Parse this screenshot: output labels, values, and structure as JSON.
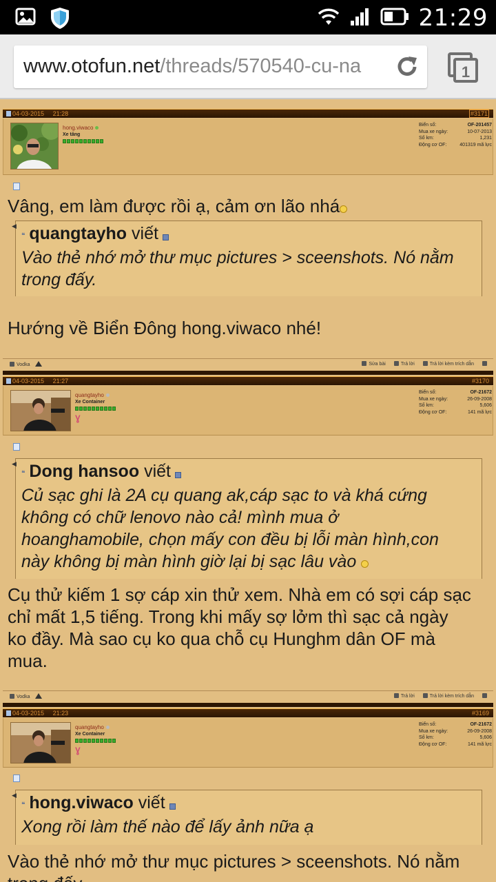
{
  "status_bar": {
    "time": "21:29"
  },
  "browser": {
    "url_domain": "www.otofun.net",
    "url_path": "/threads/570540-cu-na",
    "tab_count": "1"
  },
  "posts": [
    {
      "date": "04-03-2015",
      "time": "21:28",
      "number": "#3171",
      "username": "hong.viwaco",
      "rank": "Xe tăng",
      "stats": [
        {
          "label": "Biển số:",
          "value": "OF-201457"
        },
        {
          "label": "Mua xe ngày:",
          "value": "10-07-2013"
        },
        {
          "label": "Số km:",
          "value": "1,231"
        },
        {
          "label": "Động cơ OF:",
          "value": "401319 mã lực"
        }
      ],
      "message": "Vâng, em làm được rồi ạ, cảm ơn lão nhá",
      "quote_author": "quangtayho",
      "quote_word": "viết",
      "quote_lines": [
        "Vào thẻ nhớ mở thư mục pictures > sceenshots. Nó nằm",
        "trong đấy."
      ],
      "reply_text": "Hướng về Biển Đông hong.viwaco nhé!",
      "footer_user": "Vodka",
      "actions": [
        "Sửa bài",
        "Trả lời",
        "Trả lời kèm trích dẫn"
      ]
    },
    {
      "date": "04-03-2015",
      "time": "21:27",
      "number": "#3170",
      "username": "quangtayho",
      "rank": "Xe Container",
      "stats": [
        {
          "label": "Biển số:",
          "value": "OF-21672"
        },
        {
          "label": "Mua xe ngày:",
          "value": "26-09-2008"
        },
        {
          "label": "Số km:",
          "value": "5,606"
        },
        {
          "label": "Động cơ OF:",
          "value": "141 mã lực"
        }
      ],
      "quote_author": "Dong hansoo",
      "quote_word": "viết",
      "quote_lines": [
        "Củ sạc ghi là 2A cụ quang ak,cáp sạc to và khá cứng",
        "không có chữ lenovo nào cả! mình mua ở",
        "hoanghamobile, chọn mấy con đều bị lỗi màn hình,con",
        "này không bị màn hình giờ lại bị sạc lâu vào"
      ],
      "reply_lines": [
        "Cụ thử kiếm 1 sợ cáp xin thử xem. Nhà em có sợi cáp sạc",
        "chỉ mất 1,5 tiếng. Trong khi mấy sợ lởm thì sạc cả ngày",
        "ko đầy. Mà sao cụ ko qua chỗ cụ Hunghm dân OF mà",
        "mua."
      ],
      "footer_user": "Vodka",
      "actions": [
        "Trả lời",
        "Trả lời kèm trích dẫn"
      ]
    },
    {
      "date": "04-03-2015",
      "time": "21:23",
      "number": "#3169",
      "username": "quangtayho",
      "rank": "Xe Container",
      "stats": [
        {
          "label": "Biển số:",
          "value": "OF-21672"
        },
        {
          "label": "Mua xe ngày:",
          "value": "26-09-2008"
        },
        {
          "label": "Số km:",
          "value": "5,606"
        },
        {
          "label": "Động cơ OF:",
          "value": "141 mã lực"
        }
      ],
      "quote_author": "hong.viwaco",
      "quote_word": "viết",
      "quote_lines": [
        "Xong rồi làm thế nào để lấy ảnh nữa ạ"
      ],
      "reply_lines": [
        "Vào thẻ nhớ mở thư mục pictures > sceenshots. Nó nằm",
        "trong đấy."
      ]
    }
  ]
}
